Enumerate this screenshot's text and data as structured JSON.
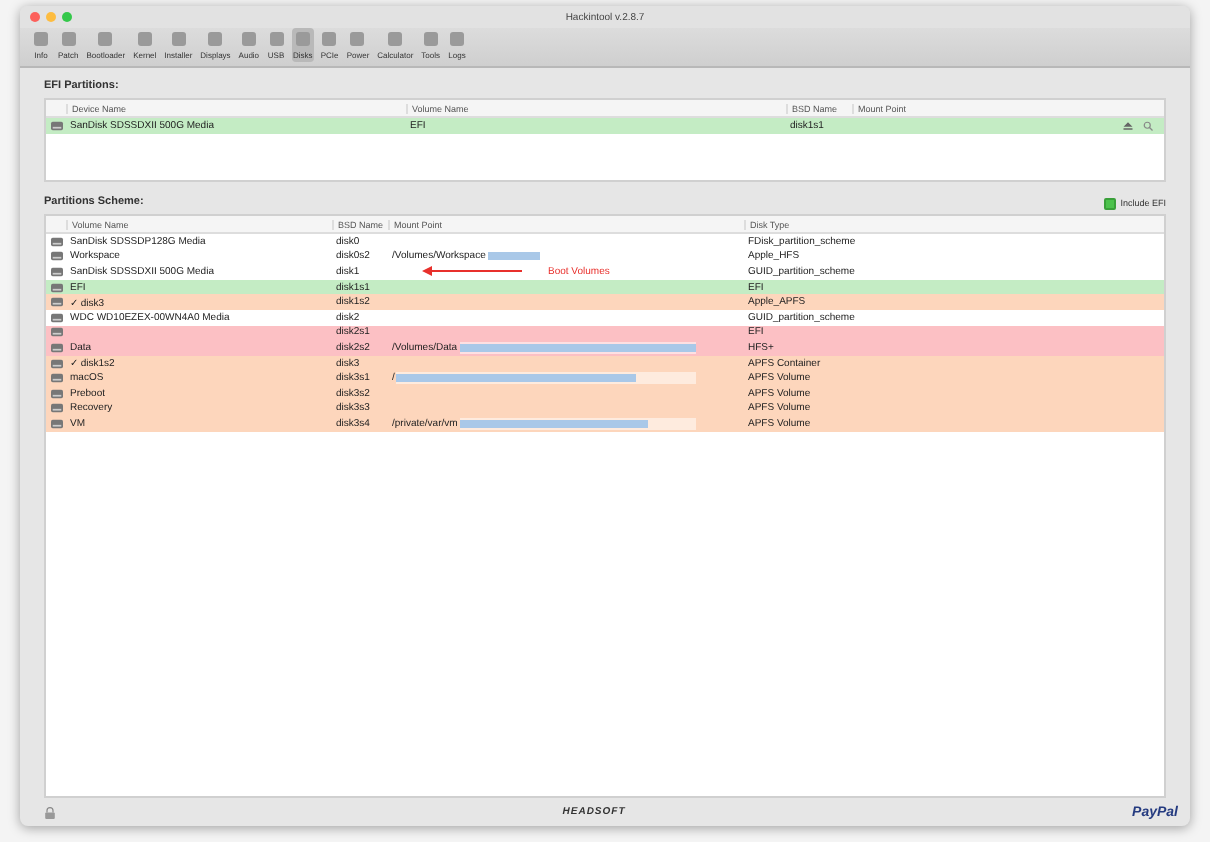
{
  "window": {
    "title": "Hackintool v.2.8.7"
  },
  "toolbar": [
    {
      "label": "Info",
      "selected": false
    },
    {
      "label": "Patch",
      "selected": false
    },
    {
      "label": "Bootloader",
      "selected": false
    },
    {
      "label": "Kernel",
      "selected": false
    },
    {
      "label": "Installer",
      "selected": false
    },
    {
      "label": "Displays",
      "selected": false
    },
    {
      "label": "Audio",
      "selected": false
    },
    {
      "label": "USB",
      "selected": false
    },
    {
      "label": "Disks",
      "selected": true
    },
    {
      "label": "PCIe",
      "selected": false
    },
    {
      "label": "Power",
      "selected": false
    },
    {
      "label": "Calculator",
      "selected": false
    },
    {
      "label": "Tools",
      "selected": false
    },
    {
      "label": "Logs",
      "selected": false
    }
  ],
  "efi_partitions": {
    "title": "EFI Partitions:",
    "columns": [
      "Device Name",
      "Volume Name",
      "BSD Name",
      "Mount Point"
    ],
    "rows": [
      {
        "device": "SanDisk SDSSDXII 500G Media",
        "volume": "EFI",
        "bsd": "disk1s1",
        "mount": "",
        "color": "#c4ecc4"
      }
    ]
  },
  "partitions_scheme": {
    "title": "Partitions Scheme:",
    "include_efi": {
      "label": "Include EFI",
      "checked": true
    },
    "columns": [
      "Volume Name",
      "BSD Name",
      "Mount Point",
      "Disk Type"
    ],
    "rows": [
      {
        "name": "SanDisk SDSSDP128G Media",
        "bsd": "disk0",
        "mount": "",
        "type": "FDisk_partition_scheme",
        "color": "#ffffff"
      },
      {
        "name": "Workspace",
        "bsd": "disk0s2",
        "mount": "/Volumes/Workspace",
        "type": "Apple_HFS",
        "color": "#ffffff",
        "level": 0.25
      },
      {
        "name": "SanDisk SDSSDXII 500G Media",
        "bsd": "disk1",
        "mount": "",
        "type": "GUID_partition_scheme",
        "color": "#ffffff",
        "annotation": "Boot Volumes"
      },
      {
        "name": "EFI",
        "bsd": "disk1s1",
        "mount": "",
        "type": "EFI",
        "color": "#c4ecc4"
      },
      {
        "name": "✓ disk3",
        "bsd": "disk1s2",
        "mount": "",
        "type": "Apple_APFS",
        "color": "#fdd6bc"
      },
      {
        "name": "WDC WD10EZEX-00WN4A0 Media",
        "bsd": "disk2",
        "mount": "",
        "type": "GUID_partition_scheme",
        "color": "#ffffff"
      },
      {
        "name": "",
        "bsd": "disk2s1",
        "mount": "",
        "type": "EFI",
        "color": "#fcc0c4"
      },
      {
        "name": "Data",
        "bsd": "disk2s2",
        "mount": "/Volumes/Data",
        "type": "HFS+",
        "color": "#fcc0c4",
        "level": 1
      },
      {
        "name": "✓ disk1s2",
        "bsd": "disk3",
        "mount": "",
        "type": "APFS Container",
        "color": "#fdd6bc"
      },
      {
        "name": "macOS",
        "bsd": "disk3s1",
        "mount": "/",
        "type": "APFS Volume",
        "color": "#fdd6bc",
        "level": 0.8
      },
      {
        "name": "Preboot",
        "bsd": "disk3s2",
        "mount": "",
        "type": "APFS Volume",
        "color": "#fdd6bc"
      },
      {
        "name": "Recovery",
        "bsd": "disk3s3",
        "mount": "",
        "type": "APFS Volume",
        "color": "#fdd6bc"
      },
      {
        "name": "VM",
        "bsd": "disk3s4",
        "mount": "/private/var/vm",
        "type": "APFS Volume",
        "color": "#fdd6bc",
        "level": 0.8
      }
    ]
  },
  "footer": {
    "logo": "HEADSOFT",
    "donate": "PayPal"
  }
}
